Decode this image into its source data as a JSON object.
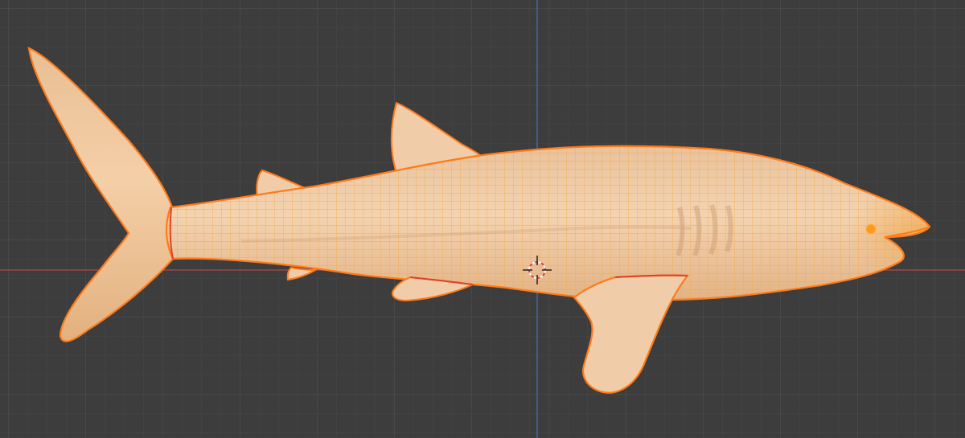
{
  "viewport": {
    "view": "orthographic-side",
    "mode": "object-mode-wireframe-overlay"
  },
  "scene": {
    "object": "whale-shark-mesh",
    "selected": true,
    "icons": [
      "3d-cursor-icon",
      "object-origin-icon"
    ]
  },
  "colors": {
    "background": "#3d3d3d",
    "grid_minor": "#474747",
    "grid_major": "#525252",
    "x_axis": "#9c4646",
    "z_axis": "#3f6aa0",
    "mesh_fill": "#f2c9a0",
    "mesh_wire": "#f5a83c",
    "selection_outline": "#ff7a1a",
    "seam": "#e0402a",
    "origin": "#ff9a1f"
  }
}
